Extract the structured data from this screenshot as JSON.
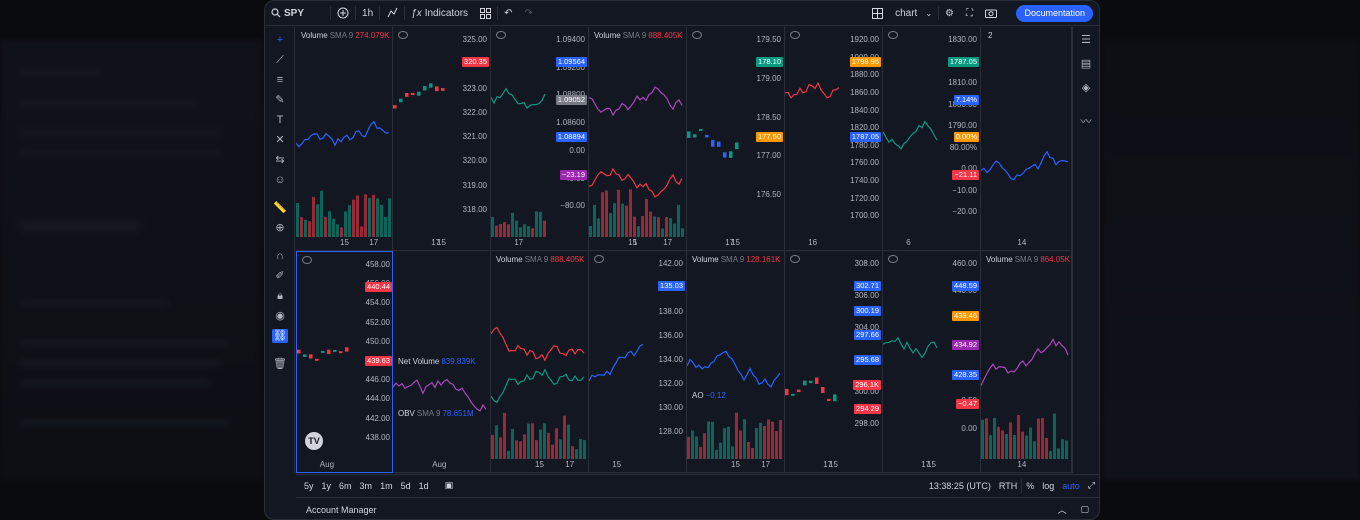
{
  "header": {
    "symbol": "SPY",
    "interval": "1h",
    "indicators": "Indicators",
    "layout_name": "chart",
    "documentation": "Documentation"
  },
  "panes": [
    {
      "id": "p1",
      "label": "Volume",
      "sma": "SMA 9",
      "value": "274.079K",
      "value_color": "#f23645",
      "x_ticks": [
        "15",
        "17"
      ],
      "y_ticks": []
    },
    {
      "id": "p2",
      "label": "",
      "sma": "",
      "value": "",
      "value_color": "#d1d4dc",
      "x_ticks": [
        "15",
        "17"
      ],
      "y_ticks": [
        "325.00",
        "324.00",
        "323.00",
        "322.00",
        "321.00",
        "320.00",
        "319.00",
        "318.00"
      ],
      "tags": [
        {
          "text": "320.35",
          "color": "#f23645"
        }
      ]
    },
    {
      "id": "p3",
      "label": "",
      "sma": "",
      "value": "",
      "value_color": "#d1d4dc",
      "x_ticks": [
        "17"
      ],
      "y_ticks": [
        "1.09400",
        "1.09200",
        "1.08800",
        "1.08600",
        "0.00",
        "−40.00",
        "−80.00"
      ],
      "tags": [
        {
          "text": "1.09564",
          "color": "#2962ff"
        },
        {
          "text": "1.09052",
          "color": "#787b86"
        },
        {
          "text": "1.08894",
          "color": "#2962ff"
        },
        {
          "text": "−23.19",
          "color": "#9c27b0"
        }
      ]
    },
    {
      "id": "p4",
      "label": "Volume",
      "sma": "SMA 9",
      "value": "888.405K",
      "value_color": "#f23645",
      "x_ticks": [
        "1",
        "15",
        "17"
      ],
      "y_ticks": []
    },
    {
      "id": "p5",
      "label": "",
      "sma": "",
      "value": "",
      "value_color": "#d1d4dc",
      "x_ticks": [
        "15",
        "17"
      ],
      "y_ticks": [
        "179.50",
        "179.00",
        "178.50",
        "177.00",
        "176.50"
      ],
      "tags": [
        {
          "text": "178.10",
          "color": "#089981"
        },
        {
          "text": "177.50",
          "color": "#ff9800"
        }
      ]
    },
    {
      "id": "p6",
      "label": "",
      "sma": "",
      "value": "",
      "value_color": "#d1d4dc",
      "x_ticks": [
        "16"
      ],
      "y_ticks": [
        "1920.00",
        "1900.00",
        "1880.00",
        "1860.00",
        "1840.00",
        "1820.00",
        "1780.00",
        "1760.00",
        "1740.00",
        "1720.00",
        "1700.00"
      ],
      "tags": [
        {
          "text": "1798.95",
          "color": "#ff9800"
        },
        {
          "text": "1787.05",
          "color": "#2962ff"
        }
      ]
    },
    {
      "id": "p7",
      "label": "",
      "sma": "",
      "value": "",
      "value_color": "#d1d4dc",
      "x_ticks": [
        "6"
      ],
      "y_ticks": [
        "1830.00",
        "1820.00",
        "1810.00",
        "1800.00",
        "1790.00",
        "80.00%",
        "0.00",
        "−10.00",
        "−20.00"
      ],
      "tags": [
        {
          "text": "1787.05",
          "color": "#089981"
        },
        {
          "text": "7.14%",
          "color": "#2962ff"
        },
        {
          "text": "0.00%",
          "color": "#ff9800"
        },
        {
          "text": "−21.11",
          "color": "#f23645"
        }
      ]
    },
    {
      "id": "p8",
      "label": "",
      "sma": "",
      "value": "2",
      "value_color": "#d1d4dc",
      "x_ticks": [
        "14"
      ],
      "y_ticks": []
    },
    {
      "id": "p9",
      "label": "",
      "sma": "",
      "value": "",
      "value_color": "#d1d4dc",
      "x_ticks": [
        "Aug"
      ],
      "y_ticks": [
        "458.00",
        "456.00",
        "454.00",
        "452.00",
        "450.00",
        "448.00",
        "446.00",
        "444.00",
        "442.00",
        "438.00"
      ],
      "tags": [
        {
          "text": "440.44",
          "color": "#f23645"
        },
        {
          "text": "439.63",
          "color": "#f23645"
        }
      ]
    },
    {
      "id": "p10",
      "label": "Net Volume",
      "sma": "",
      "value": "839.839K",
      "value_color": "#2962ff",
      "label2": "OBV",
      "sma2": "SMA 9",
      "value2": "78.651M",
      "x_ticks": [
        "Aug"
      ],
      "y_ticks": []
    },
    {
      "id": "p11",
      "label": "Volume",
      "sma": "SMA 9",
      "value": "888.405K",
      "value_color": "#f23645",
      "x_ticks": [
        "15",
        "17"
      ],
      "y_ticks": []
    },
    {
      "id": "p12",
      "label": "",
      "sma": "",
      "value": "",
      "value_color": "#d1d4dc",
      "x_ticks": [
        "15"
      ],
      "y_ticks": [
        "142.00",
        "140.00",
        "138.00",
        "136.00",
        "134.00",
        "132.00",
        "130.00",
        "128.00"
      ],
      "tags": [
        {
          "text": "135.03",
          "color": "#2962ff"
        }
      ]
    },
    {
      "id": "p13",
      "label": "Volume",
      "sma": "SMA 9",
      "value": "128.161K",
      "value_color": "#f23645",
      "label2": "AO",
      "value2": "−0.12",
      "x_ticks": [
        "15",
        "17"
      ],
      "y_ticks": []
    },
    {
      "id": "p14",
      "label": "",
      "sma": "",
      "value": "",
      "value_color": "#d1d4dc",
      "x_ticks": [
        "15",
        "17"
      ],
      "y_ticks": [
        "308.00",
        "306.00",
        "304.00",
        "302.00",
        "300.00",
        "298.00"
      ],
      "tags": [
        {
          "text": "302.71",
          "color": "#2962ff"
        },
        {
          "text": "300.19",
          "color": "#2962ff"
        },
        {
          "text": "297.66",
          "color": "#2962ff"
        },
        {
          "text": "295.68",
          "color": "#2962ff"
        },
        {
          "text": "296.1K",
          "color": "#f23645"
        },
        {
          "text": "294.29",
          "color": "#f23645"
        }
      ]
    },
    {
      "id": "p15",
      "label": "",
      "sma": "",
      "value": "",
      "value_color": "#d1d4dc",
      "x_ticks": [
        "15",
        "17"
      ],
      "y_ticks": [
        "460.00",
        "440.00",
        "420.00",
        "400.00",
        "1.00",
        "0.50",
        "0.00"
      ],
      "tags": [
        {
          "text": "448.59",
          "color": "#2962ff"
        },
        {
          "text": "438.46",
          "color": "#ff9800"
        },
        {
          "text": "434.92",
          "color": "#9c27b0"
        },
        {
          "text": "428.35",
          "color": "#2962ff"
        },
        {
          "text": "−0.47",
          "color": "#f23645"
        }
      ]
    },
    {
      "id": "p16",
      "label": "Volume",
      "sma": "SMA 9",
      "value": "864.05K",
      "value_color": "#f23645",
      "x_ticks": [
        "14"
      ],
      "y_ticks": []
    }
  ],
  "bottom": {
    "ranges": [
      "5y",
      "1y",
      "6m",
      "3m",
      "1m",
      "5d",
      "1d"
    ],
    "time": "13:38:25 (UTC)",
    "session": "RTH",
    "pct": "%",
    "log": "log",
    "auto": "auto"
  },
  "account": {
    "label": "Account Manager"
  }
}
